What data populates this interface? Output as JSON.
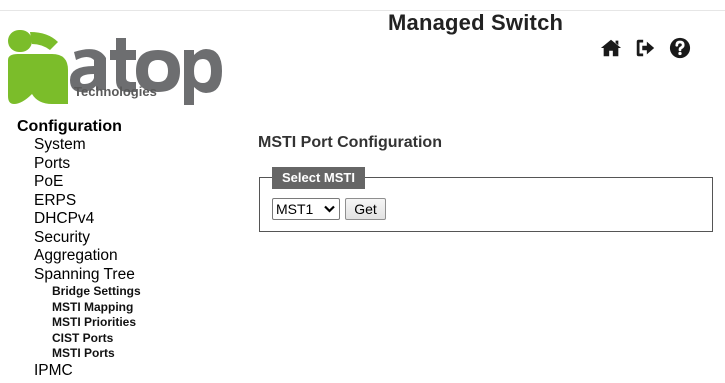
{
  "header": {
    "title": "Managed Switch",
    "logo_text": "atop",
    "logo_subtext": "Technologies",
    "icons": [
      "home-icon",
      "logout-icon",
      "help-icon"
    ]
  },
  "colors": {
    "logo_green": "#7bbd2a",
    "logo_gray": "#6d6e70",
    "legend_bg": "#666666"
  },
  "sidebar": {
    "heading": "Configuration",
    "items": [
      {
        "label": "System"
      },
      {
        "label": "Ports"
      },
      {
        "label": "PoE"
      },
      {
        "label": "ERPS"
      },
      {
        "label": "DHCPv4"
      },
      {
        "label": "Security"
      },
      {
        "label": "Aggregation"
      },
      {
        "label": "Spanning Tree"
      }
    ],
    "subitems": [
      {
        "label": "Bridge Settings"
      },
      {
        "label": "MSTI Mapping"
      },
      {
        "label": "MSTI Priorities"
      },
      {
        "label": "CIST Ports"
      },
      {
        "label": "MSTI Ports"
      }
    ],
    "last_item": {
      "label": "IPMC"
    }
  },
  "main": {
    "title": "MSTI Port Configuration",
    "fieldset_legend": "Select MSTI",
    "select_value": "MST1",
    "get_button": "Get"
  }
}
